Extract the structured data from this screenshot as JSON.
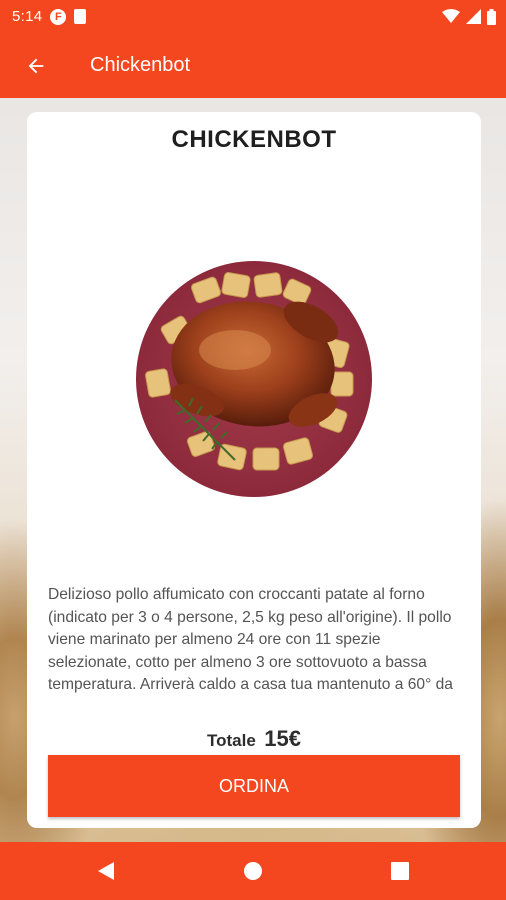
{
  "status_bar": {
    "time": "5:14",
    "f_badge": "F",
    "icons": [
      "facebook-notification-icon",
      "sd-card-icon",
      "wifi-icon",
      "cell-signal-icon",
      "battery-icon"
    ]
  },
  "app_bar": {
    "title": "Chickenbot",
    "back_icon": "arrow-back-icon"
  },
  "product": {
    "name": "CHICKENBOT",
    "image": "roast-chicken-with-potatoes-photo",
    "description": "Delizioso pollo affumicato con croccanti patate al forno (indicato per 3 o 4 persone, 2,5 kg peso all'origine). Il pollo viene marinato per almeno 24 ore con 11 spezie selezionate, cotto per almeno 3 ore sottovuoto a bassa temperatura. Arriverà caldo a casa tua mantenuto a 60° da",
    "total_label": "Totale",
    "total_price": "15€"
  },
  "actions": {
    "order_label": "ORDINA"
  },
  "nav_bar": {
    "icons": [
      "nav-back-icon",
      "nav-home-icon",
      "nav-recents-icon"
    ]
  },
  "colors": {
    "primary": "#f4471f",
    "card": "#ffffff",
    "text_dark": "#1f1f1f",
    "text_body": "#545454"
  }
}
